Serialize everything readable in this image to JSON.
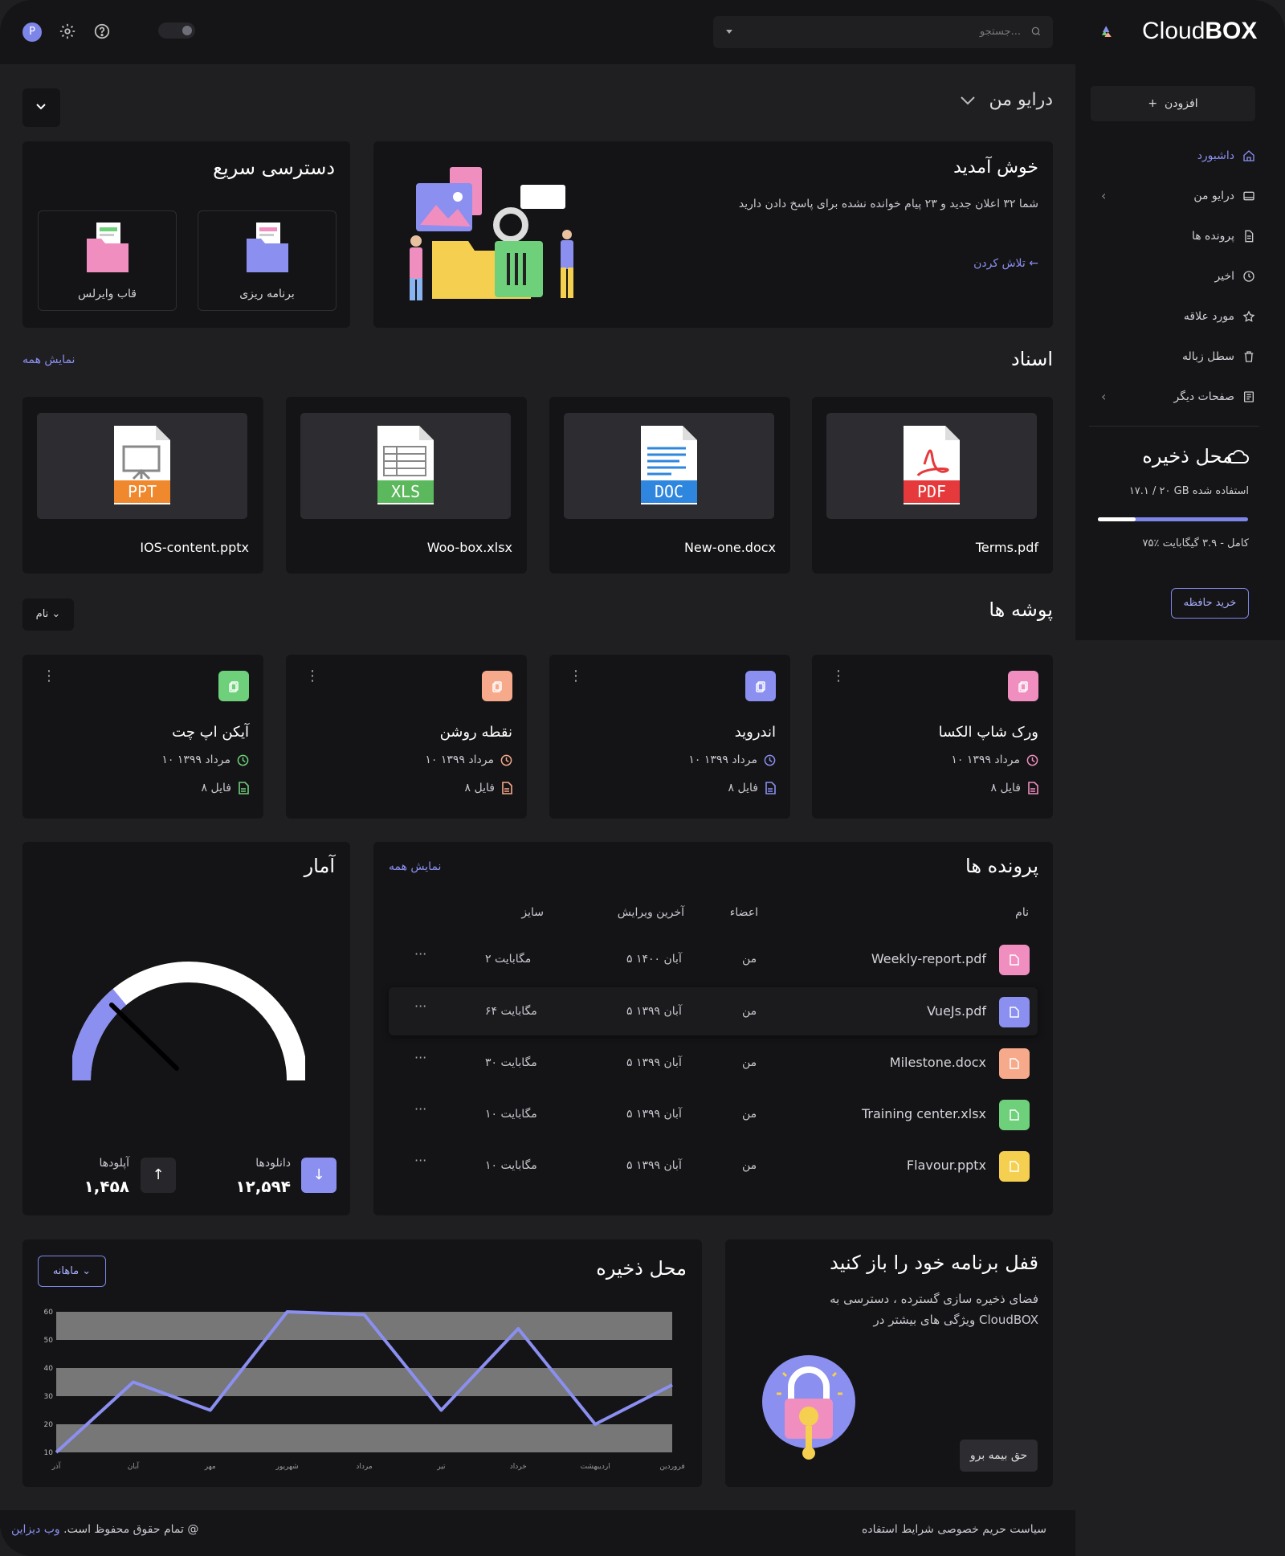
{
  "brand": {
    "name_light": "Cloud",
    "name_bold": "BOX"
  },
  "search": {
    "placeholder": "جستجو..."
  },
  "avatar": {
    "initial": "P"
  },
  "sidebar": {
    "add_label": "افزودن",
    "items": [
      {
        "label": "داشبورد",
        "icon": "home-icon",
        "active": true
      },
      {
        "label": "درایو من",
        "icon": "drive-icon"
      },
      {
        "label": "پرونده ها",
        "icon": "file-icon"
      },
      {
        "label": "اخیر",
        "icon": "clock-icon"
      },
      {
        "label": "مورد علاقه",
        "icon": "star-icon"
      },
      {
        "label": "سطل زباله",
        "icon": "trash-icon"
      },
      {
        "label": "صفحات دیگر",
        "icon": "pages-icon"
      }
    ],
    "storage": {
      "title": "محل ذخیره",
      "used": "۱۷.۱ / ۲۰ GB استفاده شده",
      "fraction": 0.75,
      "full": "۷۵٪ کامل - ۳.۹ گیگابایت",
      "buy_label": "خرید حافظه"
    }
  },
  "header": {
    "title": "درایو من"
  },
  "welcome": {
    "title": "خوش آمدید",
    "subtitle": "شما ۳۲ اعلان جدید و ۲۳ پیام خوانده نشده برای پاسخ دادن دارید",
    "link": "تلاش کردن"
  },
  "quick_access": {
    "title": "دسترسی سریع",
    "items": [
      {
        "label": "برنامه ریزی"
      },
      {
        "label": "قاب وایرلس"
      }
    ]
  },
  "documents": {
    "title": "اسناد",
    "show_all": "نمایش همه",
    "items": [
      {
        "name": "Terms.pdf",
        "badge": "PDF",
        "color": "#e5393b"
      },
      {
        "name": "New-one.docx",
        "badge": "DOC",
        "color": "#2e86de"
      },
      {
        "name": "Woo-box.xlsx",
        "badge": "XLS",
        "color": "#5cb85c"
      },
      {
        "name": "IOS-content.pptx",
        "badge": "PPT",
        "color": "#f0882e"
      }
    ]
  },
  "folders": {
    "title": "پوشه ها",
    "sort_label": "نام",
    "items": [
      {
        "name": "ورک شاپ الکسا",
        "date": "۱۰ مرداد ۱۳۹۹",
        "count": "۸ فایل",
        "color": "#f08ec0"
      },
      {
        "name": "اندروید",
        "date": "۱۰ مرداد ۱۳۹۹",
        "count": "۸ فایل",
        "color": "#8a8ff0"
      },
      {
        "name": "نقطه روشن",
        "date": "۱۰ مرداد ۱۳۹۹",
        "count": "۸ فایل",
        "color": "#f7a98c"
      },
      {
        "name": "آیکن اپ چت",
        "date": "۱۰ مرداد ۱۳۹۹",
        "count": "۸ فایل",
        "color": "#6ed07a"
      }
    ]
  },
  "stats": {
    "title": "آمار",
    "downloads_label": "دانلودها",
    "downloads": "۱۲,۵۹۴",
    "uploads_label": "آپلودها",
    "uploads": "۱,۴۵۸"
  },
  "files": {
    "title": "پرونده ها",
    "show_all": "نمایش همه",
    "columns": {
      "name": "نام",
      "members": "اعضاء",
      "edited": "آخرین ویرایش",
      "size": "سایز"
    },
    "rows": [
      {
        "name": "Weekly-report.pdf",
        "members": "من",
        "edited": "۵ آبان ۱۴۰۰",
        "size": "۲ مگابایت",
        "color": "#f08ec0"
      },
      {
        "name": "VueJs.pdf",
        "members": "من",
        "edited": "۵ آبان ۱۳۹۹",
        "size": "۶۴ مگابایت",
        "color": "#8a8ff0",
        "highlight": true
      },
      {
        "name": "Milestone.docx",
        "members": "من",
        "edited": "۵ آبان ۱۳۹۹",
        "size": "۳۰ مگابایت",
        "color": "#f7a98c"
      },
      {
        "name": "Training center.xlsx",
        "members": "من",
        "edited": "۵ آبان ۱۳۹۹",
        "size": "۱۰ مگابایت",
        "color": "#6ed07a"
      },
      {
        "name": "Flavour.pptx",
        "members": "من",
        "edited": "۵ آبان ۱۳۹۹",
        "size": "۱۰ مگابایت",
        "color": "#f5cf4f"
      }
    ]
  },
  "storage_chart": {
    "title": "محل ذخیره",
    "period_label": "ماهانه"
  },
  "chart_data": {
    "type": "line",
    "title": "محل ذخیره",
    "categories": [
      "فروردین",
      "اردیبهشت",
      "خرداد",
      "تیر",
      "مرداد",
      "شهریور",
      "مهر",
      "آبان",
      "آذر"
    ],
    "series": [
      {
        "values": [
          10,
          35,
          25,
          60,
          59,
          25,
          54,
          20,
          34
        ]
      }
    ],
    "ylim": [
      10,
      60
    ],
    "yticks": [
      10,
      20,
      30,
      40,
      50,
      60
    ],
    "color": "#8a8ff0"
  },
  "upgrade": {
    "title": "قفل برنامه خود را باز کنید",
    "subtitle": "فضای ذخیره سازی گسترده ، دسترسی به ویژگی های بیشتر در CloudBOX",
    "button": "حق بیمه برو"
  },
  "footer": {
    "copyright_prefix": "@",
    "copyright_link": "وب دیزاین",
    "copyright_suffix": "تمام حقوق محفوظ است.",
    "links": "سیاست حریم خصوصی شرایط استفاده"
  },
  "gauge": {
    "value": 0.28,
    "color": "#8a8ff0"
  },
  "colors": {
    "accent": "#8a8ff0",
    "bg": "#1f1f22",
    "panel": "#141416"
  }
}
